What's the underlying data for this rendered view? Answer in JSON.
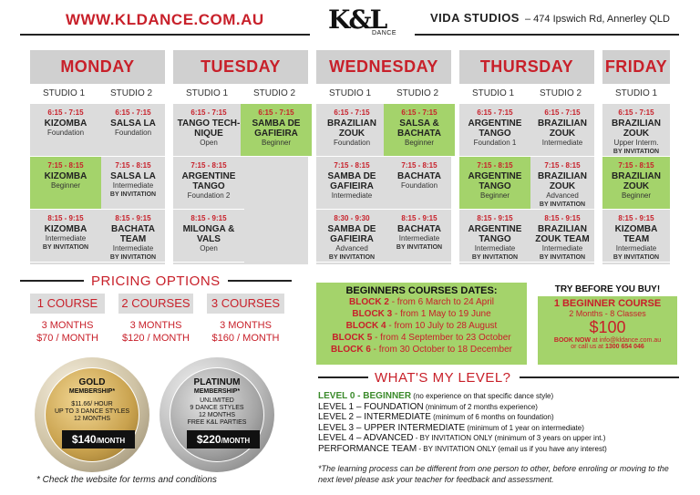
{
  "header": {
    "website": "WWW.KLDANCE.COM.AU",
    "logo_text": "K&L",
    "logo_sub": "DANCE",
    "venue_name": "VIDA STUDIOS",
    "venue_address": "– 474 Ipswich Rd, Annerley QLD"
  },
  "days": [
    {
      "name": "MONDAY",
      "studios": [
        "STUDIO 1",
        "STUDIO 2"
      ]
    },
    {
      "name": "TUESDAY",
      "studios": [
        "STUDIO 1",
        "STUDIO 2"
      ]
    },
    {
      "name": "WEDNESDAY",
      "studios": [
        "STUDIO 1",
        "STUDIO 2"
      ]
    },
    {
      "name": "THURSDAY",
      "studios": [
        "STUDIO 1",
        "STUDIO 2"
      ]
    },
    {
      "name": "FRIDAY",
      "studios": [
        "STUDIO 1"
      ]
    }
  ],
  "classes": {
    "mon1": [
      {
        "time": "6:15 - 7:15",
        "name": "KIZOMBA",
        "level": "Foundation",
        "note": ""
      },
      {
        "time": "7:15 - 8:15",
        "name": "KIZOMBA",
        "level": "Beginner",
        "note": ""
      },
      {
        "time": "8:15 - 9:15",
        "name": "KIZOMBA",
        "level": "Intermediate",
        "note": "BY INVITATION"
      }
    ],
    "mon2": [
      {
        "time": "6:15 - 7:15",
        "name": "SALSA LA",
        "level": "Foundation",
        "note": ""
      },
      {
        "time": "7:15 - 8:15",
        "name": "SALSA LA",
        "level": "Intermediate",
        "note": "BY INVITATION"
      },
      {
        "time": "8:15 - 9:15",
        "name": "BACHATA TEAM",
        "level": "Intermediate",
        "note": "BY INVITATION"
      }
    ],
    "tue1": [
      {
        "time": "6:15 - 7:15",
        "name": "TANGO TECH-NIQUE",
        "level": "Open",
        "note": ""
      },
      {
        "time": "7:15 - 8:15",
        "name": "ARGENTINE TANGO",
        "level": "Foundation 2",
        "note": ""
      },
      {
        "time": "8:15 - 9:15",
        "name": "MILONGA & VALS",
        "level": "Open",
        "note": ""
      }
    ],
    "tue2": [
      {
        "time": "6:15 - 7:15",
        "name": "SAMBA DE GAFIEIRA",
        "level": "Beginner",
        "note": ""
      }
    ],
    "wed1": [
      {
        "time": "6:15 - 7:15",
        "name": "BRAZILIAN ZOUK",
        "level": "Foundation",
        "note": ""
      },
      {
        "time": "7:15 - 8:15",
        "name": "SAMBA DE GAFIEIRA",
        "level": "Intermediate",
        "note": ""
      },
      {
        "time": "8:30 - 9:30",
        "name": "SAMBA DE GAFIEIRA",
        "level": "Advanced",
        "note": "BY INVITATION"
      }
    ],
    "wed2": [
      {
        "time": "6:15 - 7:15",
        "name": "SALSA & BACHATA",
        "level": "Beginner",
        "note": ""
      },
      {
        "time": "7:15 - 8:15",
        "name": "BACHATA",
        "level": "Foundation",
        "note": ""
      },
      {
        "time": "8:15 - 9:15",
        "name": "BACHATA",
        "level": "Intermediate",
        "note": "BY INVITATION"
      }
    ],
    "thu1": [
      {
        "time": "6:15 - 7:15",
        "name": "ARGENTINE TANGO",
        "level": "Foundation 1",
        "note": ""
      },
      {
        "time": "7:15 - 8:15",
        "name": "ARGENTINE TANGO",
        "level": "Beginner",
        "note": ""
      },
      {
        "time": "8:15 - 9:15",
        "name": "ARGENTINE TANGO",
        "level": "Intermediate",
        "note": "BY INVITATION"
      }
    ],
    "thu2": [
      {
        "time": "6:15 - 7:15",
        "name": "BRAZILIAN ZOUK",
        "level": "Intermediate",
        "note": ""
      },
      {
        "time": "7:15 - 8:15",
        "name": "BRAZILIAN ZOUK",
        "level": "Advanced",
        "note": "BY INVITATION"
      },
      {
        "time": "8:15 - 9:15",
        "name": "BRAZILIAN ZOUK TEAM",
        "level": "Intermediate",
        "note": "BY INVITATION"
      }
    ],
    "fri1": [
      {
        "time": "6:15 - 7:15",
        "name": "BRAZILIAN ZOUK",
        "level": "Upper Interm.",
        "note": "BY INVITATION"
      },
      {
        "time": "7:15 - 8:15",
        "name": "BRAZILIAN ZOUK",
        "level": "Beginner",
        "note": ""
      },
      {
        "time": "8:15 - 9:15",
        "name": "KIZOMBA TEAM",
        "level": "Intermediate",
        "note": "BY INVITATION"
      }
    ]
  },
  "pricing": {
    "title": "PRICING OPTIONS",
    "options": [
      {
        "label": "1 COURSE",
        "duration": "3 MONTHS",
        "price": "$70 / MONTH"
      },
      {
        "label": "2 COURSES",
        "duration": "3 MONTHS",
        "price": "$120 / MONTH"
      },
      {
        "label": "3 COURSES",
        "duration": "3 MONTHS",
        "price": "$160 / MONTH"
      }
    ]
  },
  "memberships": {
    "gold": {
      "name": "GOLD",
      "sub": "MEMBERSHIP*",
      "lines": [
        "$11.66/ HOUR",
        "UP TO 3 DANCE STYLES",
        "12 MONTHS"
      ],
      "price": "$140",
      "per": "/MONTH"
    },
    "platinum": {
      "name": "PLATINUM",
      "sub": "MEMBERSHIP*",
      "lines": [
        "UNLIMITED",
        "9 DANCE STYLES",
        "12 MONTHS",
        "FREE K&L PARTIES"
      ],
      "price": "$220",
      "per": "/MONTH"
    },
    "terms": "* Check the website for terms and conditions"
  },
  "beginners": {
    "title": "BEGINNERS COURSES DATES:",
    "blocks": [
      {
        "label": "BLOCK 2",
        "dates": " - from 6 March to 24 April"
      },
      {
        "label": "BLOCK 3",
        "dates": " - from 1 May to 19 June"
      },
      {
        "label": "BLOCK 4",
        "dates": " - from 10 July to 28 August"
      },
      {
        "label": "BLOCK 5",
        "dates": " - from 4 September to 23 October"
      },
      {
        "label": "BLOCK 6",
        "dates": " - from 30 October to 18 December"
      }
    ]
  },
  "try": {
    "title": "TRY BEFORE YOU BUY!",
    "offer": "1 BEGINNER COURSE",
    "sub": "2 Months - 8 Classes",
    "price": "$100",
    "book": "BOOK NOW",
    "email": " at info@kldance.com.au",
    "call": "or call us at ",
    "phone": "1300 654 046"
  },
  "levels": {
    "title": "WHAT'S MY LEVEL?",
    "items": [
      {
        "name": "LEVEL 0 - BEGINNER",
        "note": " (no experience on that specific dance style)"
      },
      {
        "name": "LEVEL 1 – FOUNDATION",
        "note": " (minimum of 2 months experience)"
      },
      {
        "name": "LEVEL 2 – INTERMEDIATE",
        "note": " (minimum of 6 months on foundation)"
      },
      {
        "name": "LEVEL 3 – UPPER INTERMEDIATE",
        "note": " (minimum of 1 year on intermediate)"
      },
      {
        "name": "LEVEL 4 – ADVANCED",
        "note": " - BY INVITATION ONLY (minimum of 3 years on upper int.)"
      },
      {
        "name": "PERFORMANCE TEAM",
        "note": " - BY INVITATION ONLY (email us if you have any interest)"
      }
    ],
    "footnote": "*The learning process can be different from one person to other, before enroling or moving to the next level please ask your teacher for feedback and assessment."
  }
}
